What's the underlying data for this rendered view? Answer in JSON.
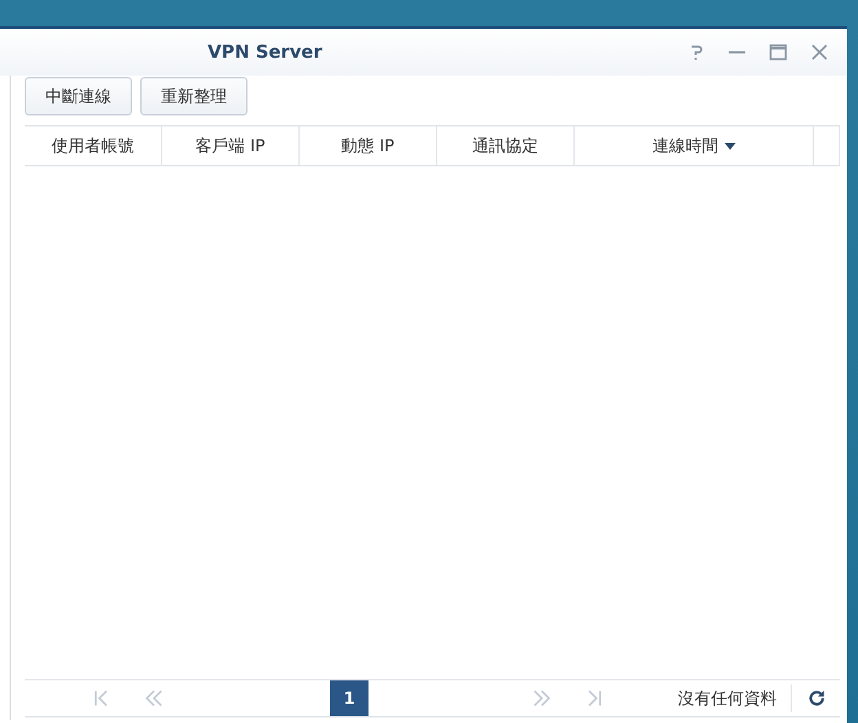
{
  "window": {
    "title": "VPN Server"
  },
  "toolbar": {
    "buttons": [
      {
        "label": "中斷連線"
      },
      {
        "label": "重新整理"
      }
    ]
  },
  "table": {
    "columns": [
      {
        "label": "使用者帳號",
        "sorted": false
      },
      {
        "label": "客戶端 IP",
        "sorted": false
      },
      {
        "label": "動態 IP",
        "sorted": false
      },
      {
        "label": "通訊協定",
        "sorted": false
      },
      {
        "label": "連線時間",
        "sorted": true
      }
    ]
  },
  "pager": {
    "nav_before": [
      {
        "kind": "first",
        "disabled": true
      },
      {
        "kind": "prev",
        "disabled": true
      }
    ],
    "pages": [
      {
        "label": "1",
        "selected": true
      }
    ],
    "nav_after": [
      {
        "kind": "next",
        "disabled": true
      },
      {
        "kind": "last",
        "disabled": true
      }
    ],
    "status": "沒有任何資料"
  }
}
